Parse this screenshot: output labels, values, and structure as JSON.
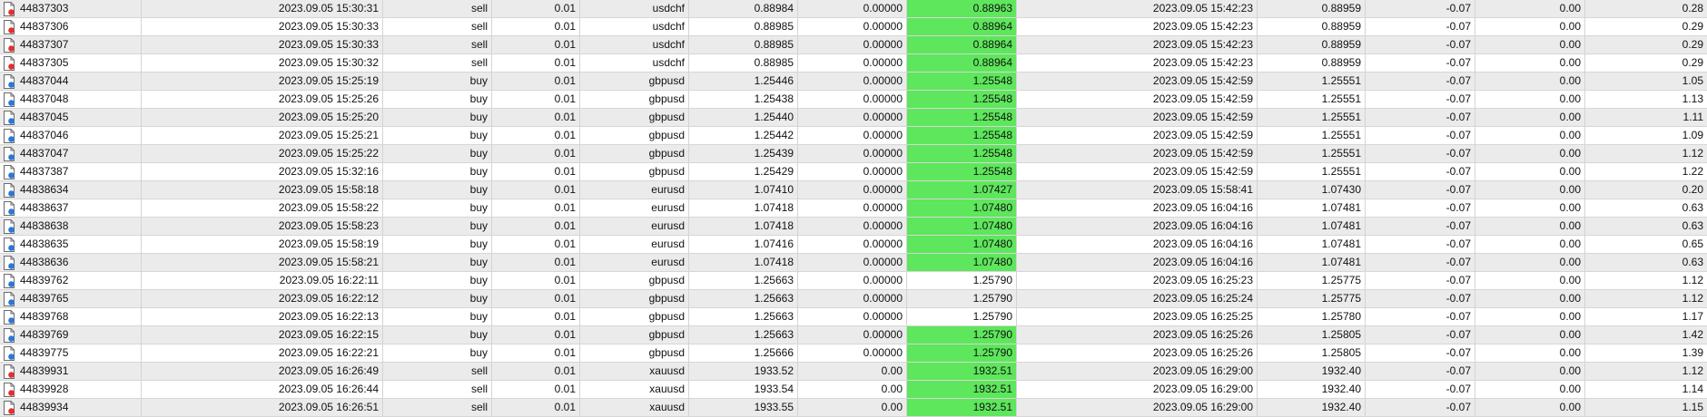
{
  "colors": {
    "row_alt_bg": "#ebebeb",
    "tp_highlight": "#5ee65c",
    "sell_marker": "#e03030",
    "buy_marker": "#2a78d6"
  },
  "icons": {
    "sell": "order-sell-icon",
    "buy": "order-buy-icon"
  },
  "rows": [
    {
      "ticket": "44837303",
      "open_time": "2023.09.05 15:30:31",
      "type": "sell",
      "volume": "0.01",
      "symbol": "usdchf",
      "open_price": "0.88984",
      "sl": "0.00000",
      "tp": "0.88963",
      "close_time": "2023.09.05 15:42:23",
      "close_price": "0.88959",
      "swap": "-0.07",
      "commission": "0.00",
      "profit": "0.28",
      "tp_hit": true
    },
    {
      "ticket": "44837306",
      "open_time": "2023.09.05 15:30:33",
      "type": "sell",
      "volume": "0.01",
      "symbol": "usdchf",
      "open_price": "0.88985",
      "sl": "0.00000",
      "tp": "0.88964",
      "close_time": "2023.09.05 15:42:23",
      "close_price": "0.88959",
      "swap": "-0.07",
      "commission": "0.00",
      "profit": "0.29",
      "tp_hit": true
    },
    {
      "ticket": "44837307",
      "open_time": "2023.09.05 15:30:33",
      "type": "sell",
      "volume": "0.01",
      "symbol": "usdchf",
      "open_price": "0.88985",
      "sl": "0.00000",
      "tp": "0.88964",
      "close_time": "2023.09.05 15:42:23",
      "close_price": "0.88959",
      "swap": "-0.07",
      "commission": "0.00",
      "profit": "0.29",
      "tp_hit": true
    },
    {
      "ticket": "44837305",
      "open_time": "2023.09.05 15:30:32",
      "type": "sell",
      "volume": "0.01",
      "symbol": "usdchf",
      "open_price": "0.88985",
      "sl": "0.00000",
      "tp": "0.88964",
      "close_time": "2023.09.05 15:42:23",
      "close_price": "0.88959",
      "swap": "-0.07",
      "commission": "0.00",
      "profit": "0.29",
      "tp_hit": true
    },
    {
      "ticket": "44837044",
      "open_time": "2023.09.05 15:25:19",
      "type": "buy",
      "volume": "0.01",
      "symbol": "gbpusd",
      "open_price": "1.25446",
      "sl": "0.00000",
      "tp": "1.25548",
      "close_time": "2023.09.05 15:42:59",
      "close_price": "1.25551",
      "swap": "-0.07",
      "commission": "0.00",
      "profit": "1.05",
      "tp_hit": true
    },
    {
      "ticket": "44837048",
      "open_time": "2023.09.05 15:25:26",
      "type": "buy",
      "volume": "0.01",
      "symbol": "gbpusd",
      "open_price": "1.25438",
      "sl": "0.00000",
      "tp": "1.25548",
      "close_time": "2023.09.05 15:42:59",
      "close_price": "1.25551",
      "swap": "-0.07",
      "commission": "0.00",
      "profit": "1.13",
      "tp_hit": true
    },
    {
      "ticket": "44837045",
      "open_time": "2023.09.05 15:25:20",
      "type": "buy",
      "volume": "0.01",
      "symbol": "gbpusd",
      "open_price": "1.25440",
      "sl": "0.00000",
      "tp": "1.25548",
      "close_time": "2023.09.05 15:42:59",
      "close_price": "1.25551",
      "swap": "-0.07",
      "commission": "0.00",
      "profit": "1.11",
      "tp_hit": true
    },
    {
      "ticket": "44837046",
      "open_time": "2023.09.05 15:25:21",
      "type": "buy",
      "volume": "0.01",
      "symbol": "gbpusd",
      "open_price": "1.25442",
      "sl": "0.00000",
      "tp": "1.25548",
      "close_time": "2023.09.05 15:42:59",
      "close_price": "1.25551",
      "swap": "-0.07",
      "commission": "0.00",
      "profit": "1.09",
      "tp_hit": true
    },
    {
      "ticket": "44837047",
      "open_time": "2023.09.05 15:25:22",
      "type": "buy",
      "volume": "0.01",
      "symbol": "gbpusd",
      "open_price": "1.25439",
      "sl": "0.00000",
      "tp": "1.25548",
      "close_time": "2023.09.05 15:42:59",
      "close_price": "1.25551",
      "swap": "-0.07",
      "commission": "0.00",
      "profit": "1.12",
      "tp_hit": true
    },
    {
      "ticket": "44837387",
      "open_time": "2023.09.05 15:32:16",
      "type": "buy",
      "volume": "0.01",
      "symbol": "gbpusd",
      "open_price": "1.25429",
      "sl": "0.00000",
      "tp": "1.25548",
      "close_time": "2023.09.05 15:42:59",
      "close_price": "1.25551",
      "swap": "-0.07",
      "commission": "0.00",
      "profit": "1.22",
      "tp_hit": true
    },
    {
      "ticket": "44838634",
      "open_time": "2023.09.05 15:58:18",
      "type": "buy",
      "volume": "0.01",
      "symbol": "eurusd",
      "open_price": "1.07410",
      "sl": "0.00000",
      "tp": "1.07427",
      "close_time": "2023.09.05 15:58:41",
      "close_price": "1.07430",
      "swap": "-0.07",
      "commission": "0.00",
      "profit": "0.20",
      "tp_hit": true
    },
    {
      "ticket": "44838637",
      "open_time": "2023.09.05 15:58:22",
      "type": "buy",
      "volume": "0.01",
      "symbol": "eurusd",
      "open_price": "1.07418",
      "sl": "0.00000",
      "tp": "1.07480",
      "close_time": "2023.09.05 16:04:16",
      "close_price": "1.07481",
      "swap": "-0.07",
      "commission": "0.00",
      "profit": "0.63",
      "tp_hit": true
    },
    {
      "ticket": "44838638",
      "open_time": "2023.09.05 15:58:23",
      "type": "buy",
      "volume": "0.01",
      "symbol": "eurusd",
      "open_price": "1.07418",
      "sl": "0.00000",
      "tp": "1.07480",
      "close_time": "2023.09.05 16:04:16",
      "close_price": "1.07481",
      "swap": "-0.07",
      "commission": "0.00",
      "profit": "0.63",
      "tp_hit": true
    },
    {
      "ticket": "44838635",
      "open_time": "2023.09.05 15:58:19",
      "type": "buy",
      "volume": "0.01",
      "symbol": "eurusd",
      "open_price": "1.07416",
      "sl": "0.00000",
      "tp": "1.07480",
      "close_time": "2023.09.05 16:04:16",
      "close_price": "1.07481",
      "swap": "-0.07",
      "commission": "0.00",
      "profit": "0.65",
      "tp_hit": true
    },
    {
      "ticket": "44838636",
      "open_time": "2023.09.05 15:58:21",
      "type": "buy",
      "volume": "0.01",
      "symbol": "eurusd",
      "open_price": "1.07418",
      "sl": "0.00000",
      "tp": "1.07480",
      "close_time": "2023.09.05 16:04:16",
      "close_price": "1.07481",
      "swap": "-0.07",
      "commission": "0.00",
      "profit": "0.63",
      "tp_hit": true
    },
    {
      "ticket": "44839762",
      "open_time": "2023.09.05 16:22:11",
      "type": "buy",
      "volume": "0.01",
      "symbol": "gbpusd",
      "open_price": "1.25663",
      "sl": "0.00000",
      "tp": "1.25790",
      "close_time": "2023.09.05 16:25:23",
      "close_price": "1.25775",
      "swap": "-0.07",
      "commission": "0.00",
      "profit": "1.12",
      "tp_hit": false
    },
    {
      "ticket": "44839765",
      "open_time": "2023.09.05 16:22:12",
      "type": "buy",
      "volume": "0.01",
      "symbol": "gbpusd",
      "open_price": "1.25663",
      "sl": "0.00000",
      "tp": "1.25790",
      "close_time": "2023.09.05 16:25:24",
      "close_price": "1.25775",
      "swap": "-0.07",
      "commission": "0.00",
      "profit": "1.12",
      "tp_hit": false
    },
    {
      "ticket": "44839768",
      "open_time": "2023.09.05 16:22:13",
      "type": "buy",
      "volume": "0.01",
      "symbol": "gbpusd",
      "open_price": "1.25663",
      "sl": "0.00000",
      "tp": "1.25790",
      "close_time": "2023.09.05 16:25:25",
      "close_price": "1.25780",
      "swap": "-0.07",
      "commission": "0.00",
      "profit": "1.17",
      "tp_hit": false
    },
    {
      "ticket": "44839769",
      "open_time": "2023.09.05 16:22:15",
      "type": "buy",
      "volume": "0.01",
      "symbol": "gbpusd",
      "open_price": "1.25663",
      "sl": "0.00000",
      "tp": "1.25790",
      "close_time": "2023.09.05 16:25:26",
      "close_price": "1.25805",
      "swap": "-0.07",
      "commission": "0.00",
      "profit": "1.42",
      "tp_hit": true
    },
    {
      "ticket": "44839775",
      "open_time": "2023.09.05 16:22:21",
      "type": "buy",
      "volume": "0.01",
      "symbol": "gbpusd",
      "open_price": "1.25666",
      "sl": "0.00000",
      "tp": "1.25790",
      "close_time": "2023.09.05 16:25:26",
      "close_price": "1.25805",
      "swap": "-0.07",
      "commission": "0.00",
      "profit": "1.39",
      "tp_hit": true
    },
    {
      "ticket": "44839931",
      "open_time": "2023.09.05 16:26:49",
      "type": "sell",
      "volume": "0.01",
      "symbol": "xauusd",
      "open_price": "1933.52",
      "sl": "0.00",
      "tp": "1932.51",
      "close_time": "2023.09.05 16:29:00",
      "close_price": "1932.40",
      "swap": "-0.07",
      "commission": "0.00",
      "profit": "1.12",
      "tp_hit": true
    },
    {
      "ticket": "44839928",
      "open_time": "2023.09.05 16:26:44",
      "type": "sell",
      "volume": "0.01",
      "symbol": "xauusd",
      "open_price": "1933.54",
      "sl": "0.00",
      "tp": "1932.51",
      "close_time": "2023.09.05 16:29:00",
      "close_price": "1932.40",
      "swap": "-0.07",
      "commission": "0.00",
      "profit": "1.14",
      "tp_hit": true
    },
    {
      "ticket": "44839934",
      "open_time": "2023.09.05 16:26:51",
      "type": "sell",
      "volume": "0.01",
      "symbol": "xauusd",
      "open_price": "1933.55",
      "sl": "0.00",
      "tp": "1932.51",
      "close_time": "2023.09.05 16:29:00",
      "close_price": "1932.40",
      "swap": "-0.07",
      "commission": "0.00",
      "profit": "1.15",
      "tp_hit": true
    }
  ]
}
